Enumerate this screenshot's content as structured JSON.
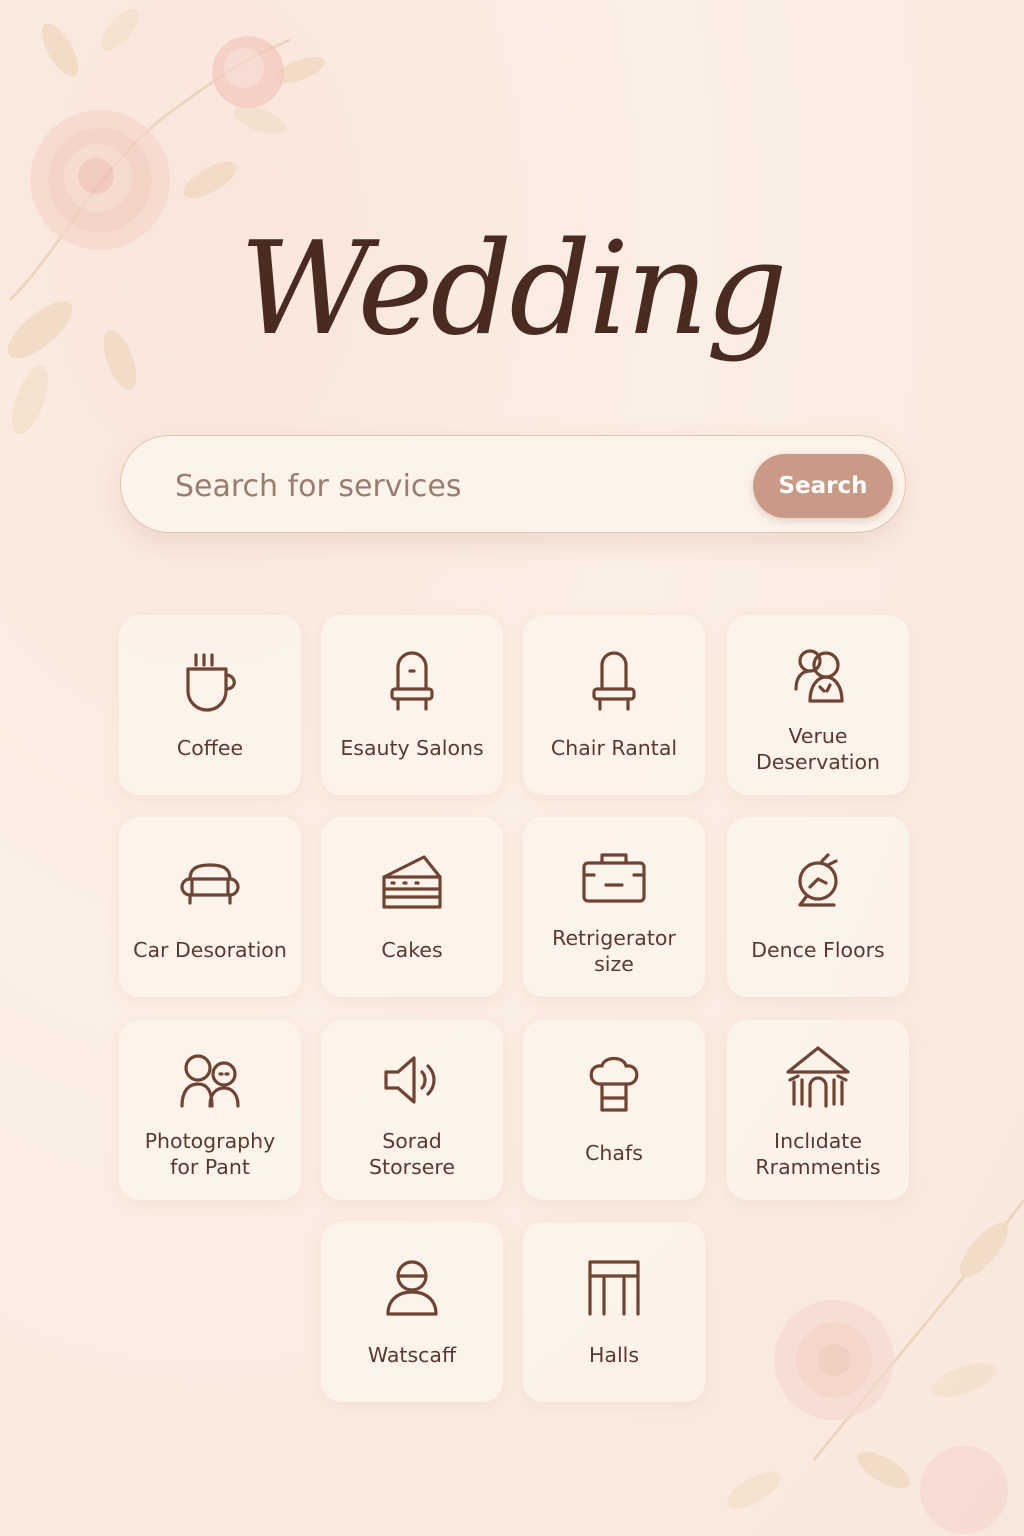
{
  "header": {
    "title": "Wedding"
  },
  "search": {
    "placeholder": "Search for services",
    "button_label": "Search"
  },
  "services": [
    {
      "label": "Coffee",
      "icon": "coffee-icon"
    },
    {
      "label": "Esauty Salons",
      "icon": "salon-chair-icon"
    },
    {
      "label": "Chair Rantal",
      "icon": "chair-icon"
    },
    {
      "label": "Verue\nDeservation",
      "icon": "venue-people-icon"
    },
    {
      "label": "Car Desoration",
      "icon": "car-icon"
    },
    {
      "label": "Cakes",
      "icon": "cake-slice-icon"
    },
    {
      "label": "Retrigerator\nsize",
      "icon": "refrigerator-icon"
    },
    {
      "label": "Dence Floors",
      "icon": "disco-icon"
    },
    {
      "label": "Photography\nfor Pant",
      "icon": "photography-people-icon"
    },
    {
      "label": "Sorad\nStorsere",
      "icon": "speaker-icon"
    },
    {
      "label": "Chafs",
      "icon": "chef-hat-icon"
    },
    {
      "label": "Inclıdate\nRrammеntis",
      "icon": "pavilion-icon"
    },
    {
      "label": "Watscaff",
      "icon": "person-icon"
    },
    {
      "label": "Halls",
      "icon": "hall-icon"
    }
  ],
  "colors": {
    "accent": "#c99b86",
    "text": "#4a2b22",
    "background": "#fbeee4"
  }
}
